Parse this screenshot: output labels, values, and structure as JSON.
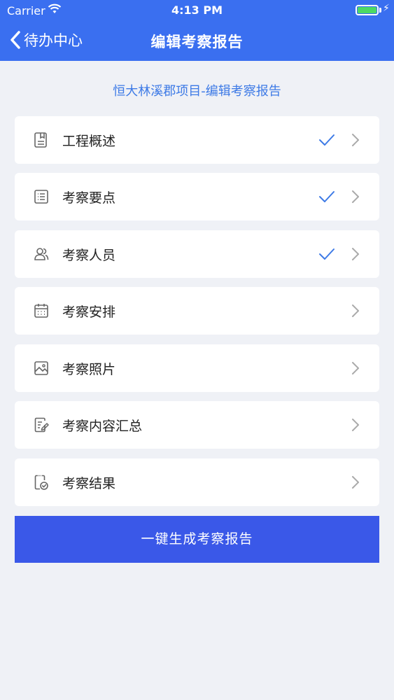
{
  "status_bar": {
    "carrier": "Carrier",
    "time": "4:13 PM",
    "battery_color": "#4cd964"
  },
  "nav": {
    "back_label": "待办中心",
    "title": "编辑考察报告",
    "bg_color": "#3a6ff0"
  },
  "subtitle": "恒大林溪郡项目-编辑考察报告",
  "sections": [
    {
      "label": "工程概述",
      "icon": "document-icon",
      "completed": true
    },
    {
      "label": "考察要点",
      "icon": "list-icon",
      "completed": true
    },
    {
      "label": " 考察人员",
      "icon": "people-icon",
      "completed": true
    },
    {
      "label": "考察安排",
      "icon": "calendar-icon",
      "completed": false
    },
    {
      "label": "考察照片",
      "icon": "image-icon",
      "completed": false
    },
    {
      "label": "考察内容汇总",
      "icon": "edit-note-icon",
      "completed": false
    },
    {
      "label": "考察结果",
      "icon": "clipboard-check-icon",
      "completed": false
    }
  ],
  "generate_button": "一键生成考察报告",
  "colors": {
    "accent": "#3d7ae6",
    "button": "#3a58e8",
    "background": "#eff1f6"
  }
}
